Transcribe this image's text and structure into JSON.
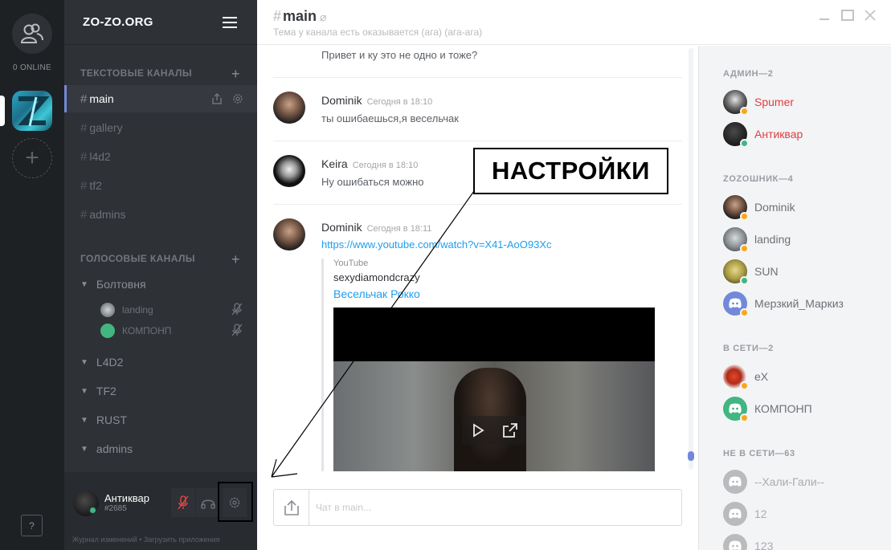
{
  "rail": {
    "online_label": "0 ONLINE",
    "help_label": "?"
  },
  "guild": {
    "name": "ZO-ZO.ORG"
  },
  "sidebar": {
    "text_category": "ТЕКСТОВЫЕ КАНАЛЫ",
    "text_channels": [
      "main",
      "gallery",
      "l4d2",
      "tf2",
      "admins"
    ],
    "voice_category": "ГОЛОСОВЫЕ КАНАЛЫ",
    "voice_channels": [
      "Болтовня",
      "L4D2",
      "TF2",
      "RUST",
      "admins"
    ],
    "voice_users": [
      "landing",
      "КОМПОНП"
    ]
  },
  "user_panel": {
    "name": "Антиквар",
    "tag": "#2685",
    "footer": "Журнал изменений  •  Загрузить приложения"
  },
  "header": {
    "channel": "main",
    "topic": "Тема у канала есть оказывается (ага) (ага-ага)"
  },
  "messages": [
    {
      "author": "",
      "time": "",
      "text": "Привет и ку это не одно и тоже?"
    },
    {
      "author": "Dominik",
      "time": "Сегодня в 18:10",
      "text": "ты ошибаешься,я весельчак"
    },
    {
      "author": "Keira",
      "time": "Сегодня в 18:10",
      "text": "Ну ошибаться можно"
    },
    {
      "author": "Dominik",
      "time": "Сегодня в 18:11",
      "text": "https://www.youtube.com/watch?v=X41-AoO93Xc"
    }
  ],
  "embed": {
    "provider": "YouTube",
    "author": "sexydiamondcrazy",
    "title": "Весельчак Рокко"
  },
  "input": {
    "placeholder": "Чат в main..."
  },
  "members": {
    "roles": [
      "АДМИН—2",
      "ZOZОШНИК—4",
      "В СЕТИ—2",
      "НЕ В СЕТИ—63"
    ],
    "admins": [
      "Spumer",
      "Антиквар"
    ],
    "zozoshnik": [
      "Dominik",
      "landing",
      "SUN",
      "Мерзкий_Маркиз"
    ],
    "online": [
      "eX",
      "КОМПОНП"
    ],
    "offline": [
      "--Хали-Гали--",
      "12",
      "123"
    ]
  },
  "annotation": {
    "callout": "НАСТРОЙКИ"
  },
  "colors": {
    "accent": "#7289da",
    "online": "#43b581",
    "idle": "#faa61a",
    "admin": "#e03e3e",
    "link": "#1e9ef0"
  }
}
